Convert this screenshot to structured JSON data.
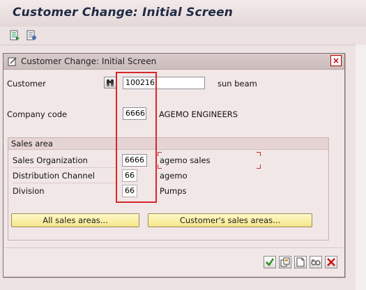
{
  "window": {
    "title": "Customer Change: Initial Screen"
  },
  "toolbar": {
    "icons": [
      "document-execute-icon",
      "document-list-icon"
    ]
  },
  "dialog": {
    "title": "Customer Change: Initial Screen",
    "customer": {
      "label": "Customer",
      "value": "100216",
      "description": "sun beam"
    },
    "company_code": {
      "label": "Company code",
      "value": "6666",
      "description": "AGEMO ENGINEERS"
    },
    "sales_area": {
      "title": "Sales area",
      "sales_org": {
        "label": "Sales Organization",
        "value": "6666",
        "description": "agemo sales"
      },
      "distribution_channel": {
        "label": "Distribution Channel",
        "value": "66",
        "description": "agemo"
      },
      "division": {
        "label": "Division",
        "value": "66",
        "description": "Pumps"
      },
      "buttons": {
        "all_sales_areas": "All sales areas...",
        "customers_sales_areas": "Customer's sales areas..."
      }
    },
    "footer_icons": [
      "continue-check-icon",
      "copy-icon",
      "new-document-icon",
      "glasses-display-icon",
      "cancel-x-icon"
    ]
  },
  "colors": {
    "highlight": "#d62828",
    "button_yellow": "#f5e68a",
    "dialog_background": "#f2e7e7"
  }
}
